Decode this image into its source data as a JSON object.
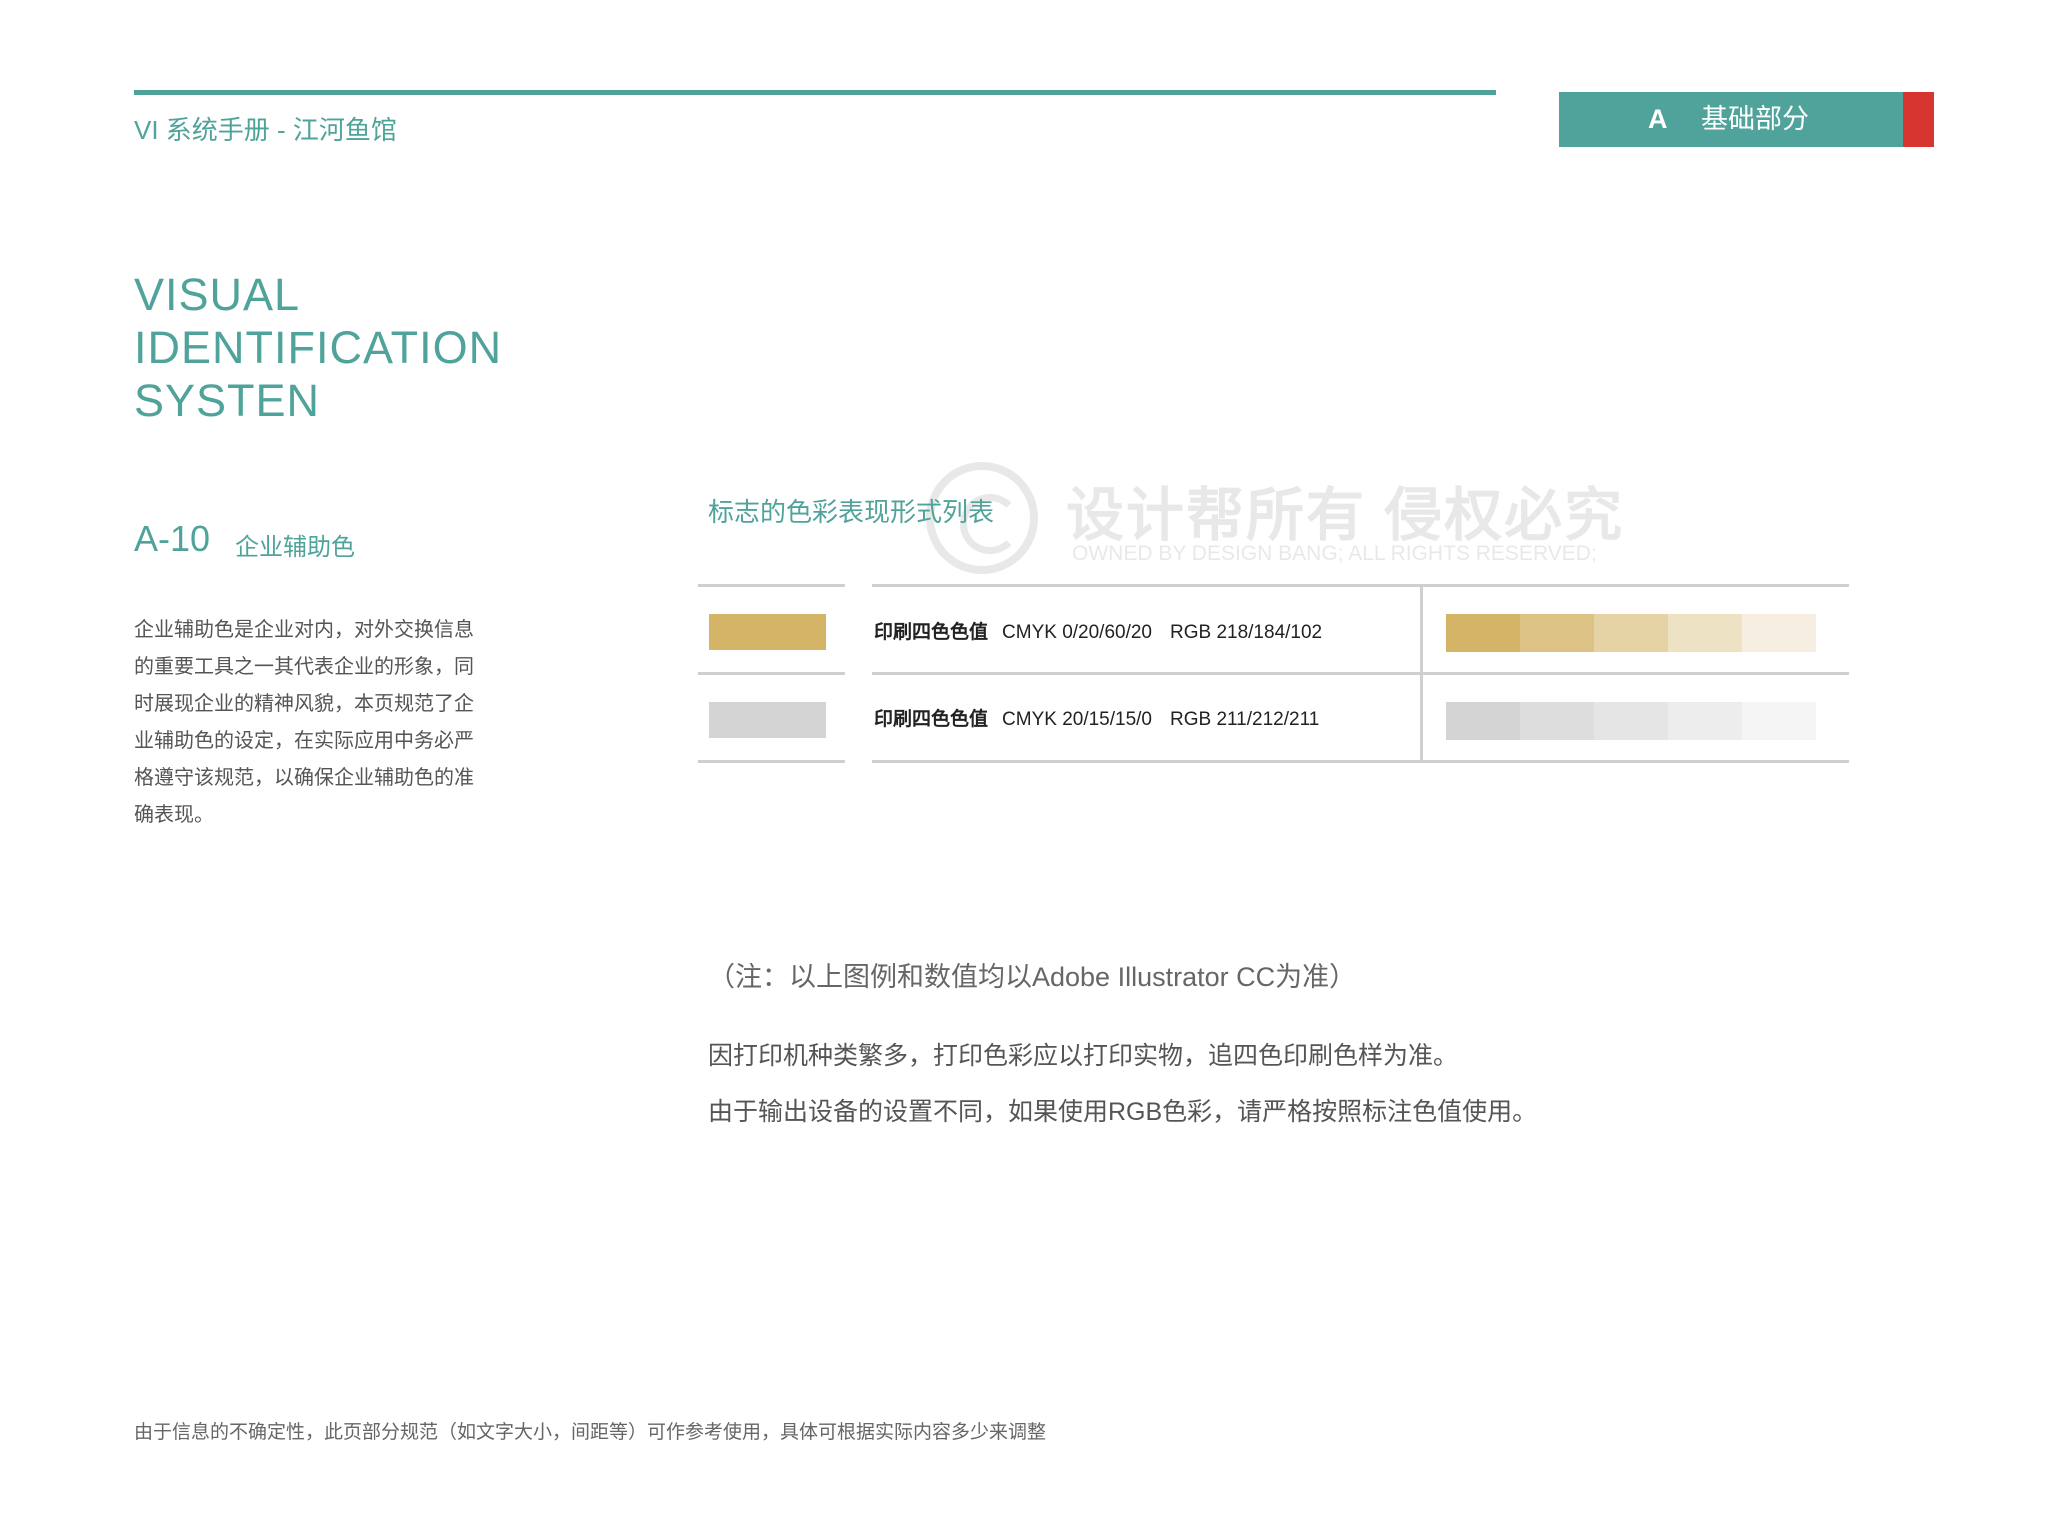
{
  "header": {
    "title": "VI 系统手册 - 江河鱼馆",
    "section_letter": "A",
    "section_name": "基础部分",
    "accent_color": "#4fa39a",
    "tab_accent_color": "#d6362f"
  },
  "title_block": {
    "line1": "VISUAL",
    "line2": "IDENTIFICATION",
    "line3": "SYSTEN"
  },
  "section": {
    "code": "A-10",
    "subtitle": "企业辅助色",
    "description": "企业辅助色是企业对内，对外交换信息的重要工具之一其代表企业的形象，同时展现企业的精神风貌，本页规范了企业辅助色的设定，在实际应用中务必严格遵守该规范，以确保企业辅助色的准确表现。"
  },
  "watermark": {
    "cn": "设计帮所有 侵权必究",
    "en": "OWNED BY DESIGN BANG; ALL RIGHTS RESERVED;"
  },
  "color_table": {
    "title": "标志的色彩表现形式列表",
    "rows": [
      {
        "label": "印刷四色色值",
        "cmyk": "CMYK  0/20/60/20",
        "rgb": "RGB 218/184/102",
        "swatch_color": "#d4b466",
        "tints": [
          "#d4b466",
          "#dcc284",
          "#e5d3a6",
          "#eee2c5",
          "#f6efe1"
        ]
      },
      {
        "label": "印刷四色色值",
        "cmyk": "CMYK  20/15/15/0",
        "rgb": "RGB 211/212/211",
        "swatch_color": "#d3d4d3",
        "tints": [
          "#d3d4d3",
          "#dcdddc",
          "#e5e5e5",
          "#ededed",
          "#f5f5f5"
        ]
      }
    ]
  },
  "notes": {
    "note": "（注：以上图例和数值均以Adobe Illustrator CC为准）",
    "para1": "因打印机种类繁多，打印色彩应以打印实物，追四色印刷色样为准。",
    "para2": "由于输出设备的设置不同，如果使用RGB色彩，请严格按照标注色值使用。"
  },
  "footer": {
    "note": "由于信息的不确定性，此页部分规范（如文字大小，间距等）可作参考使用，具体可根据实际内容多少来调整"
  }
}
